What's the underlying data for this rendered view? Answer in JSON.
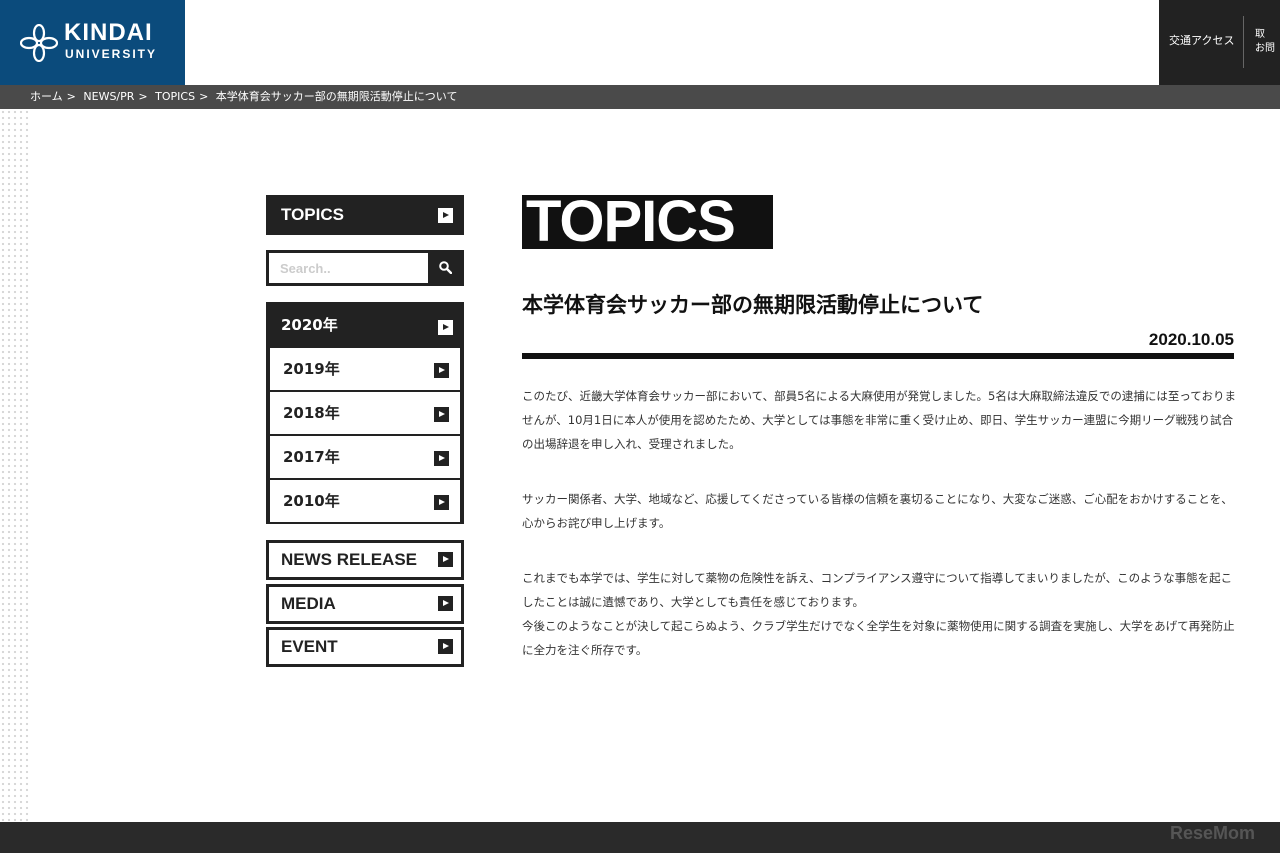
{
  "header": {
    "logo_name": "KINDAI",
    "logo_sub": "UNIVERSITY",
    "access_link": "交通アクセス",
    "cut_link_line1": "取",
    "cut_link_line2": "お問"
  },
  "breadcrumb": [
    {
      "label": "ホーム"
    },
    {
      "label": "NEWS/PR"
    },
    {
      "label": "TOPICS"
    },
    {
      "label": "本学体育会サッカー部の無期限活動停止について"
    }
  ],
  "breadcrumb_sep": ">",
  "sidebar": {
    "topics_label": "TOPICS",
    "search_placeholder": "Search..",
    "years": [
      {
        "label": "2020年"
      },
      {
        "label": "2019年"
      },
      {
        "label": "2018年"
      },
      {
        "label": "2017年"
      },
      {
        "label": "2010年"
      }
    ],
    "categories": [
      {
        "label": "NEWS RELEASE"
      },
      {
        "label": "MEDIA"
      },
      {
        "label": "EVENT"
      }
    ]
  },
  "main": {
    "section_title": "TOPICS",
    "article_title": "本学体育会サッカー部の無期限活動停止について",
    "article_date": "2020.10.05",
    "paragraphs": [
      "このたび、近畿大学体育会サッカー部において、部員5名による大麻使用が発覚しました。5名は大麻取締法違反での逮捕には至っておりませんが、10月1日に本人が使用を認めたため、大学としては事態を非常に重く受け止め、即日、学生サッカー連盟に今期リーグ戦残り試合の出場辞退を申し入れ、受理されました。",
      "サッカー関係者、大学、地域など、応援してくださっている皆様の信頼を裏切ることになり、大変なご迷惑、ご心配をおかけすることを、心からお詫び申し上げます。",
      "これまでも本学では、学生に対して薬物の危険性を訴え、コンプライアンス遵守について指導してまいりましたが、このような事態を起こしたことは誠に遺憾であり、大学としても責任を感じております。",
      "今後このようなことが決して起こらぬよう、クラブ学生だけでなく全学生を対象に薬物使用に関する調査を実施し、大学をあげて再発防止に全力を注ぐ所存です。"
    ]
  },
  "watermark": "ReseMom",
  "colors": {
    "brand_blue": "#0b4b7c",
    "dark": "#222222",
    "breadcrumb_bg": "#4a4a4a"
  },
  "icons": [
    "kindai-logo-icon",
    "search-icon",
    "arrow-right-icon"
  ]
}
